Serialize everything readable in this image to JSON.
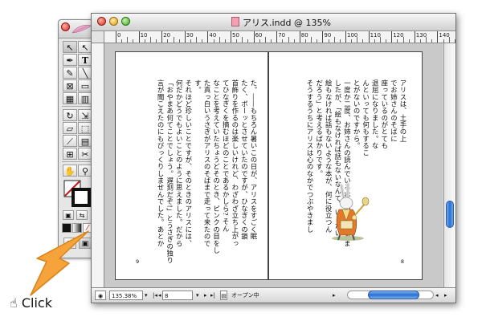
{
  "window": {
    "title": "アリス.indd @ 135%"
  },
  "ruler": {
    "h_ticks": [
      "0",
      "10",
      "20",
      "30",
      "40",
      "50",
      "60",
      "70",
      "80",
      "90",
      "100",
      "110",
      "120",
      "130",
      "140"
    ]
  },
  "page_left": {
    "number": "9",
    "text_columns": [
      "た。――もちろん暑いこの日が、アリスをすごく眠",
      "たく、ボーッとさせていたのですが、ひなぎくの鎖",
      "首飾りを作るのは楽しいけれど、わざわざ立ち上がっ",
      "てひなぎくを摘むほどのことであるかしら? そん",
      "なことを考えていたちょうどそのとき、ピンクの目をし",
      "た真っ白いうさぎがアリスのそばまで走って来たので",
      "す。",
      "それほど珍しいことですが、そのときのアリスには、",
      "何だかどうでもよいことのように思えました。だから",
      "「おやまあ何てことでしょう。遅刻だぞ!」とうさぎの独り",
      "言が聞こえたのにもびっくりしませんでした。あとか"
    ]
  },
  "page_right": {
    "number": "8",
    "text_columns": [
      "アリスは、土手の上",
      "でお姉さんのそばに",
      "座っているのがとても",
      "退屈になりました。な",
      "んといっても何もするこ",
      "とがないのですから。",
      "一度か二度、お姉さんの読んでいる本をのぞき込みま",
      "したが、「絵もなければ話もないなんて、いったい",
      "絵もなければ話もないような本が、何に役立つん",
      "だろう」と考えるばかりです。",
      "そうするうちにアリスは心のなかでつぶやきまし"
    ]
  },
  "status": {
    "zoom": "135.38%",
    "page": "8",
    "state": "オープン中"
  },
  "callout": {
    "label": "Click"
  },
  "colors": {
    "arrow": "#f5a33a",
    "scroll_thumb": "#2a6fd0",
    "pasteboard": "#c9c9c9"
  },
  "icons": [
    "close-icon",
    "feather-logo",
    "selection-tool-icon",
    "direct-selection-tool-icon",
    "pen-tool-icon",
    "type-tool-icon",
    "pencil-tool-icon",
    "line-tool-icon",
    "rectangle-frame-tool-icon",
    "rectangle-tool-icon",
    "table-icon",
    "rotate-tool-icon",
    "scale-tool-icon",
    "shear-tool-icon",
    "free-transform-tool-icon",
    "eyedropper-tool-icon",
    "gradient-tool-icon",
    "button-tool-icon",
    "scissors-tool-icon",
    "hand-tool-icon",
    "zoom-tool-icon",
    "fill-stroke-icon",
    "swap-icon",
    "default-colors-icon",
    "color-mode-icon",
    "normal-view-icon",
    "preview-view-icon",
    "white-rabbit-illustration"
  ]
}
